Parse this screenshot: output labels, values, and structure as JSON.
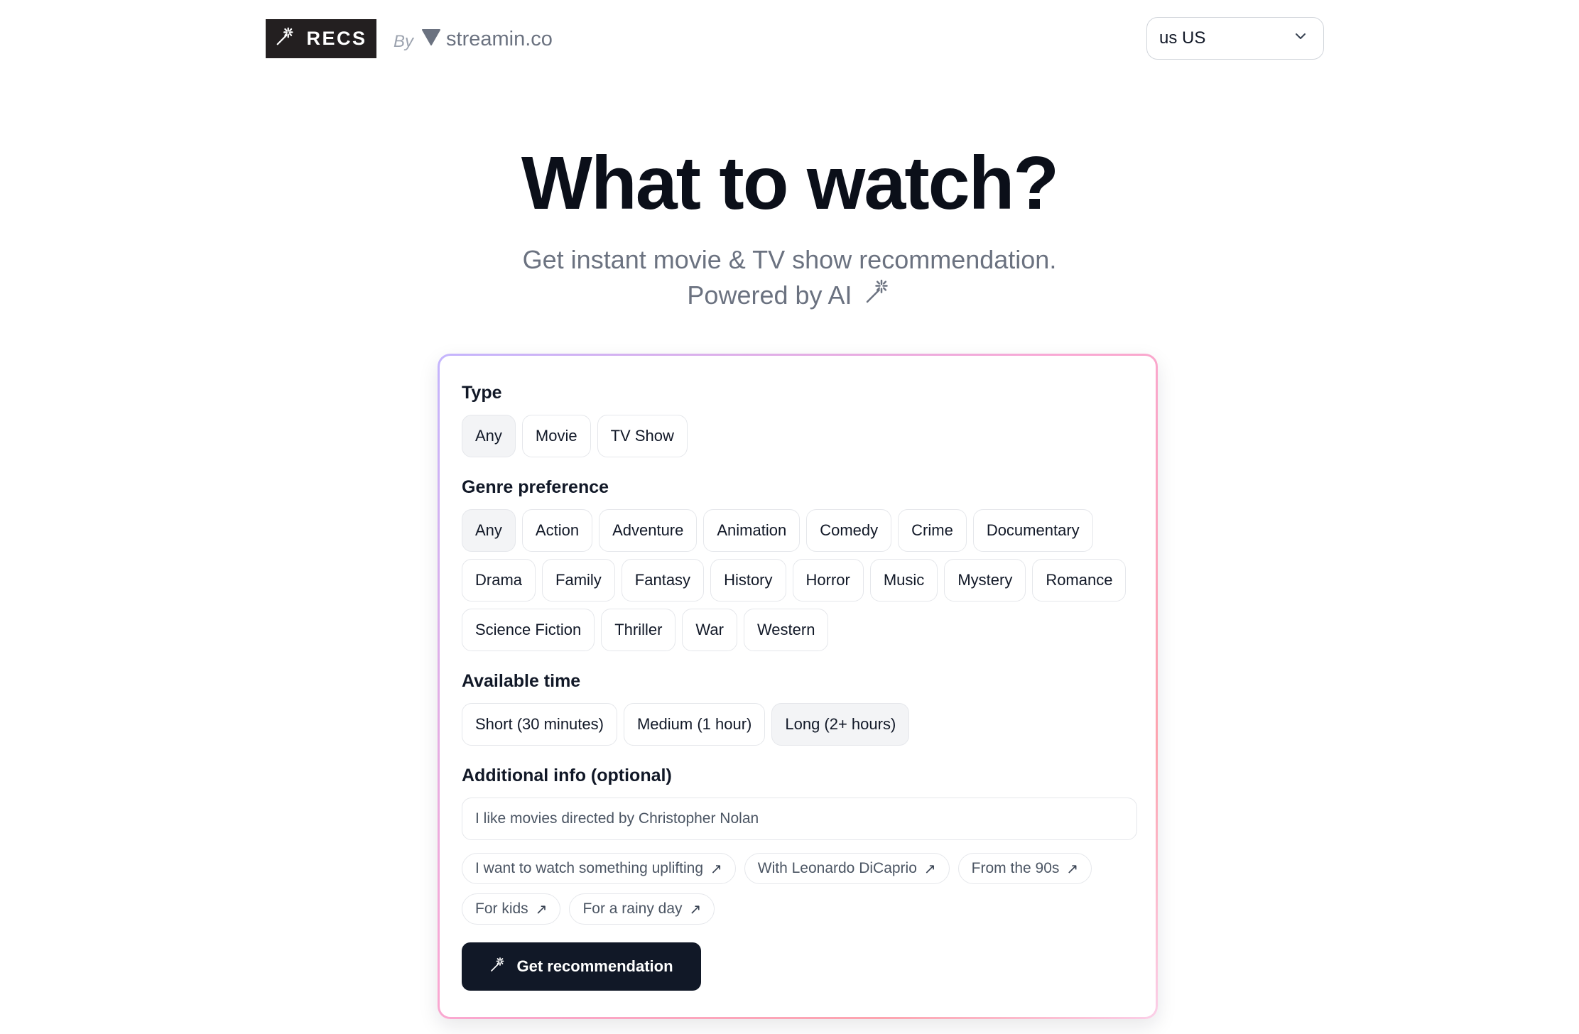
{
  "header": {
    "logo_text": "RECS",
    "by_label": "By",
    "partner": "streamin.co",
    "region": {
      "flag_code": "us",
      "value": "US"
    }
  },
  "hero": {
    "title": "What to watch?",
    "subtitle_line1": "Get instant movie & TV show recommendation.",
    "subtitle_line2": "Powered by AI"
  },
  "form": {
    "type": {
      "label": "Type",
      "options": [
        {
          "label": "Any",
          "selected": true
        },
        {
          "label": "Movie",
          "selected": false
        },
        {
          "label": "TV Show",
          "selected": false
        }
      ]
    },
    "genre": {
      "label": "Genre preference",
      "options": [
        {
          "label": "Any",
          "selected": true
        },
        {
          "label": "Action",
          "selected": false
        },
        {
          "label": "Adventure",
          "selected": false
        },
        {
          "label": "Animation",
          "selected": false
        },
        {
          "label": "Comedy",
          "selected": false
        },
        {
          "label": "Crime",
          "selected": false
        },
        {
          "label": "Documentary",
          "selected": false
        },
        {
          "label": "Drama",
          "selected": false
        },
        {
          "label": "Family",
          "selected": false
        },
        {
          "label": "Fantasy",
          "selected": false
        },
        {
          "label": "History",
          "selected": false
        },
        {
          "label": "Horror",
          "selected": false
        },
        {
          "label": "Music",
          "selected": false
        },
        {
          "label": "Mystery",
          "selected": false
        },
        {
          "label": "Romance",
          "selected": false
        },
        {
          "label": "Science Fiction",
          "selected": false
        },
        {
          "label": "Thriller",
          "selected": false
        },
        {
          "label": "War",
          "selected": false
        },
        {
          "label": "Western",
          "selected": false
        }
      ]
    },
    "time": {
      "label": "Available time",
      "options": [
        {
          "label": "Short (30 minutes)",
          "selected": false
        },
        {
          "label": "Medium (1 hour)",
          "selected": false
        },
        {
          "label": "Long (2+ hours)",
          "selected": true
        }
      ]
    },
    "additional": {
      "label": "Additional info (optional)",
      "value": "",
      "placeholder": "I like movies directed by Christopher Nolan",
      "suggestions": [
        "I want to watch something uplifting",
        "With Leonardo DiCaprio",
        "From the 90s",
        "For kids",
        "For a rainy day"
      ]
    },
    "submit_label": "Get recommendation"
  },
  "colors": {
    "dark": "#111827",
    "logo_bg": "#231f20",
    "muted_text": "#6b7280",
    "chip_selected_bg": "#f3f4f6",
    "card_border_from": "#c4b5fd",
    "card_border_to": "#fda4af"
  },
  "icons": {
    "logo": "magic-wand-icon",
    "partner": "streamin-shield-icon",
    "region_toggle": "chevron-down-icon",
    "hero": "magic-wand-icon",
    "suggestion": "arrow-up-right-icon",
    "submit": "magic-wand-icon"
  }
}
